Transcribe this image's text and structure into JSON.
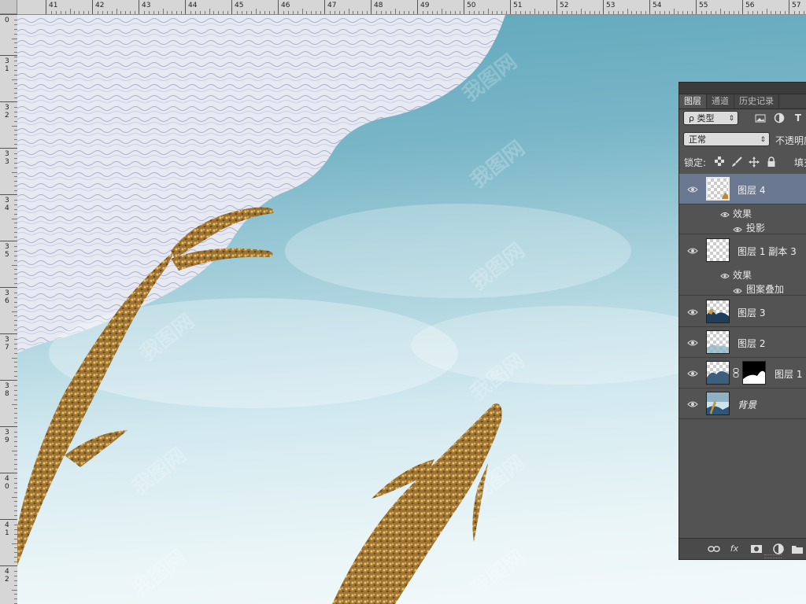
{
  "rulers": {
    "horizontal_labels": [
      "41",
      "42",
      "43",
      "44",
      "45",
      "46",
      "47",
      "48",
      "49",
      "50",
      "51",
      "52",
      "53",
      "54",
      "55",
      "56",
      "57"
    ],
    "vertical_labels": [
      "0",
      "3 1",
      "3 2",
      "3 3",
      "3 4",
      "3 5",
      "3 6",
      "3 7",
      "3 8",
      "3 9",
      "4 0",
      "4 1",
      "4 2"
    ]
  },
  "canvas": {
    "watermark_text": "我图网"
  },
  "layers_panel": {
    "tabs": [
      {
        "label": "图层",
        "active": true
      },
      {
        "label": "通道",
        "active": false
      },
      {
        "label": "历史记录",
        "active": false
      }
    ],
    "filter": {
      "label": "ρ 类型",
      "icons": [
        "image-filter-icon",
        "adjustment-filter-icon",
        "text-filter-icon"
      ],
      "text_icon_glyph": "T"
    },
    "blend_mode": {
      "value": "正常",
      "opacity_label": "不透明度"
    },
    "lock": {
      "label": "锁定:",
      "fill_label": "填充"
    },
    "layers": [
      {
        "name": "图层 4",
        "selected": true,
        "effects_label": "效果",
        "effects": [
          "投影"
        ]
      },
      {
        "name": "图层 1 副本 3",
        "selected": false,
        "effects_label": "效果",
        "effects": [
          "图案叠加"
        ]
      },
      {
        "name": "图层 3",
        "selected": false
      },
      {
        "name": "图层 2",
        "selected": false
      },
      {
        "name": "图层 1",
        "selected": false,
        "has_mask": true
      },
      {
        "name": "背景",
        "selected": false,
        "italic": true
      }
    ],
    "bottom_icons": [
      "link-icon",
      "fx-icon",
      "mask-icon",
      "adjustment-icon",
      "folder-icon"
    ],
    "fx_glyph": "fx"
  }
}
